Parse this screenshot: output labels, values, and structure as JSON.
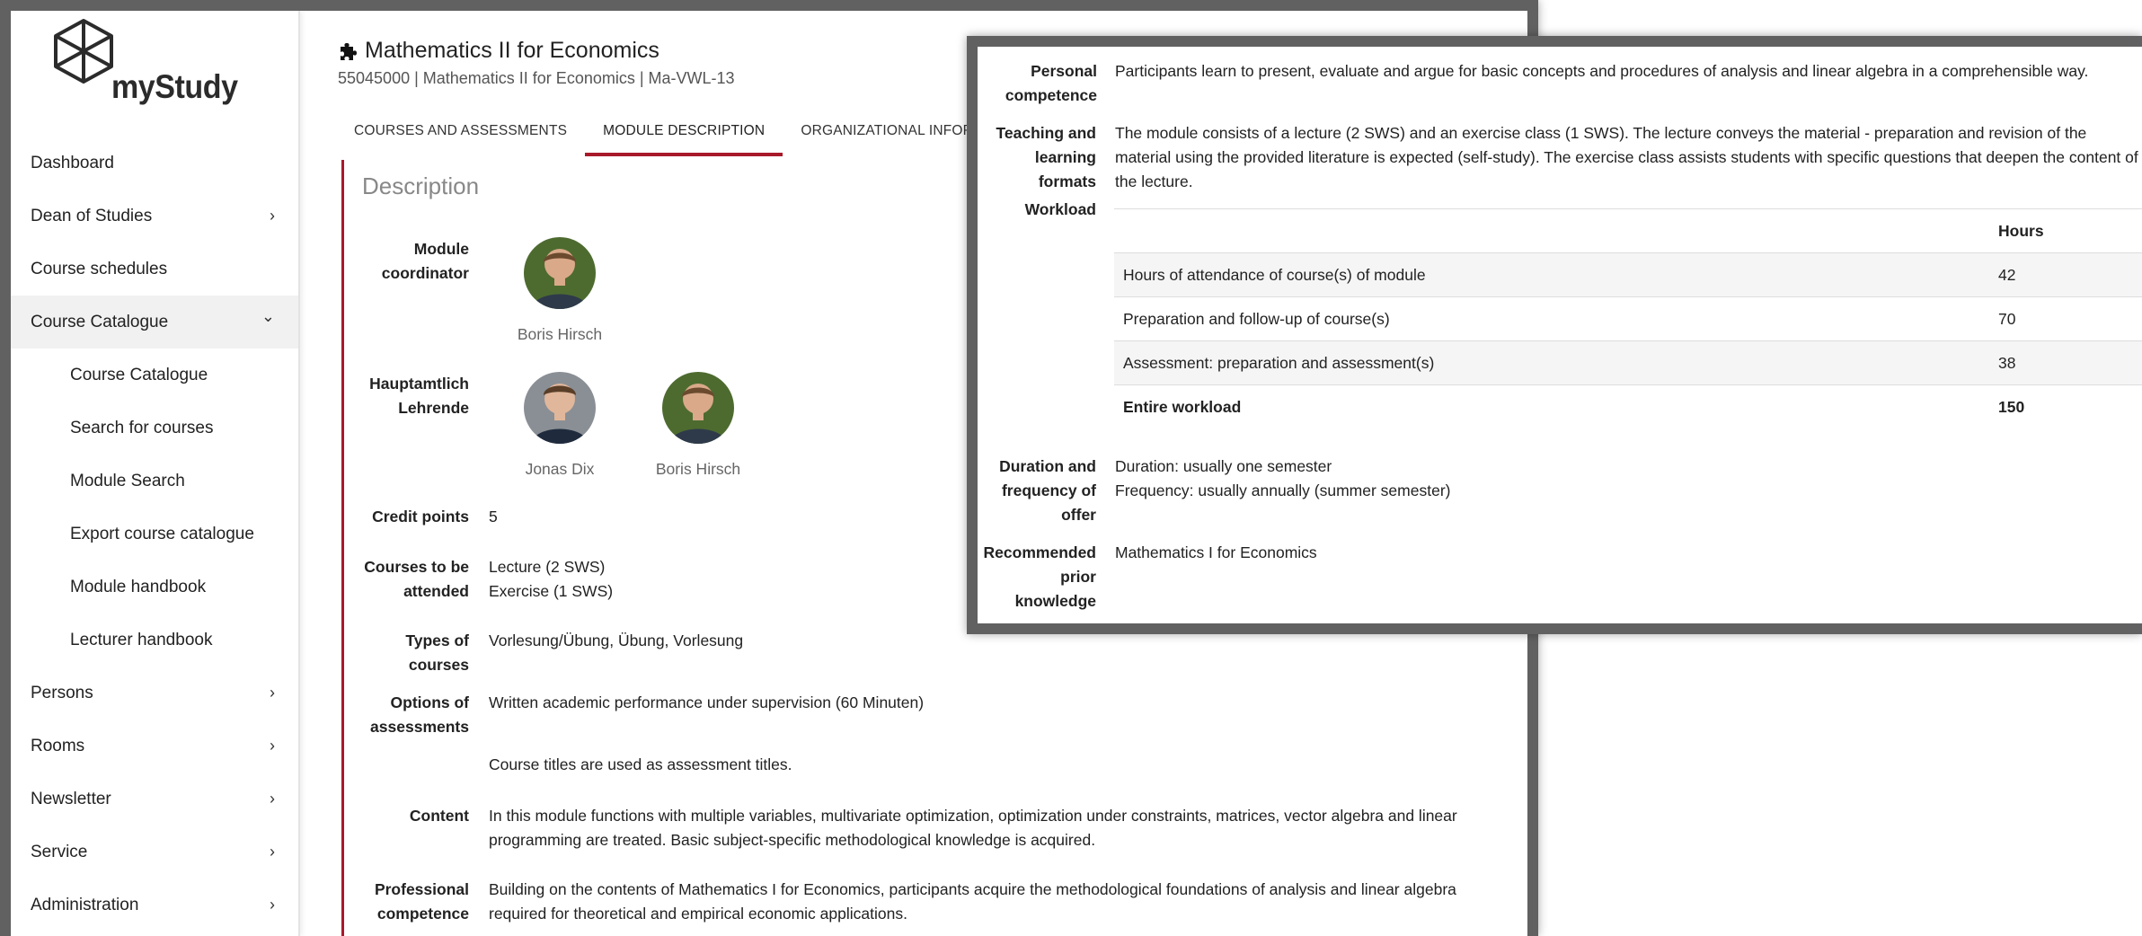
{
  "app": {
    "logo_text": "myStudy"
  },
  "sidebar": {
    "items": [
      {
        "label": "Dashboard",
        "chevron": ""
      },
      {
        "label": "Dean of Studies",
        "chevron": "›"
      },
      {
        "label": "Course schedules",
        "chevron": ""
      },
      {
        "label": "Course Catalogue",
        "chevron": "⌄"
      },
      {
        "label": "Course Catalogue",
        "chevron": ""
      },
      {
        "label": "Search for courses",
        "chevron": ""
      },
      {
        "label": "Module Search",
        "chevron": ""
      },
      {
        "label": "Export course catalogue",
        "chevron": ""
      },
      {
        "label": "Module handbook",
        "chevron": ""
      },
      {
        "label": "Lecturer handbook",
        "chevron": ""
      },
      {
        "label": "Persons",
        "chevron": "›"
      },
      {
        "label": "Rooms",
        "chevron": "›"
      },
      {
        "label": "Newsletter",
        "chevron": "›"
      },
      {
        "label": "Service",
        "chevron": "›"
      },
      {
        "label": "Administration",
        "chevron": "›"
      }
    ]
  },
  "header": {
    "title": "Mathematics II for Economics",
    "subtitle": "55045000 | Mathematics II for Economics | Ma-VWL-13"
  },
  "tabs": [
    {
      "label": "COURSES AND ASSESSMENTS"
    },
    {
      "label": "MODULE DESCRIPTION"
    },
    {
      "label": "ORGANIZATIONAL INFORMATION"
    }
  ],
  "description": {
    "section_title": "Description",
    "module_coordinator": {
      "label": "Module coordinator",
      "names": [
        "Boris Hirsch"
      ]
    },
    "lecturers": {
      "label": "Hauptamtlich Lehrende",
      "names": [
        "Jonas Dix",
        "Boris Hirsch"
      ]
    },
    "credit_points": {
      "label": "Credit points",
      "value": "5"
    },
    "courses": {
      "label": "Courses to be attended",
      "lines": [
        "Lecture (2 SWS)",
        "Exercise (1 SWS)"
      ]
    },
    "types": {
      "label": "Types of courses",
      "value": "Vorlesung/Übung, Übung, Vorlesung"
    },
    "assessments": {
      "label": "Options of assessments",
      "value": "Written academic performance under supervision (60 Minuten)",
      "note": "Course titles are used as assessment titles."
    },
    "content": {
      "label": "Content",
      "value": "In this module functions with multiple variables, multivariate optimization, optimization under constraints, matrices, vector algebra and linear programming are treated. Basic subject-specific methodological knowledge is acquired."
    },
    "professional_competence": {
      "label": "Professional competence",
      "value": "Building on the contents of Mathematics I for Economics, participants acquire the methodological foundations of analysis and linear algebra required for theoretical and empirical economic applications."
    }
  },
  "overlay": {
    "personal_competence": {
      "label": "Personal competence",
      "value": "Participants learn to present, evaluate and argue for basic concepts and procedures of analysis and linear algebra in a comprehensible way."
    },
    "teaching_formats": {
      "label": "Teaching and learning formats",
      "value": "The module consists of a lecture (2 SWS) and an exercise class (1 SWS). The lecture conveys the material - preparation and revision of the material using the provided literature is expected (self-study). The exercise class assists students with specific questions that deepen the content of the lecture."
    },
    "workload": {
      "label": "Workload",
      "column_header": "Hours",
      "rows": [
        {
          "item": "Hours of attendance of course(s) of module",
          "hours": "42"
        },
        {
          "item": "Preparation and follow-up of course(s)",
          "hours": "70"
        },
        {
          "item": "Assessment: preparation and assessment(s)",
          "hours": "38"
        },
        {
          "item": "Entire workload",
          "hours": "150"
        }
      ]
    },
    "duration": {
      "label": "Duration and frequency of offer",
      "lines": [
        "Duration: usually one semester",
        "Frequency: usually annually (summer semester)"
      ]
    },
    "prior_knowledge": {
      "label": "Recommended prior knowledge",
      "value": "Mathematics I for Economics"
    }
  },
  "colors": {
    "accent": "#a8192a",
    "frame": "#616161"
  },
  "icons": {
    "title_icon": "puzzle-icon",
    "logo_icon": "cube-icon"
  }
}
